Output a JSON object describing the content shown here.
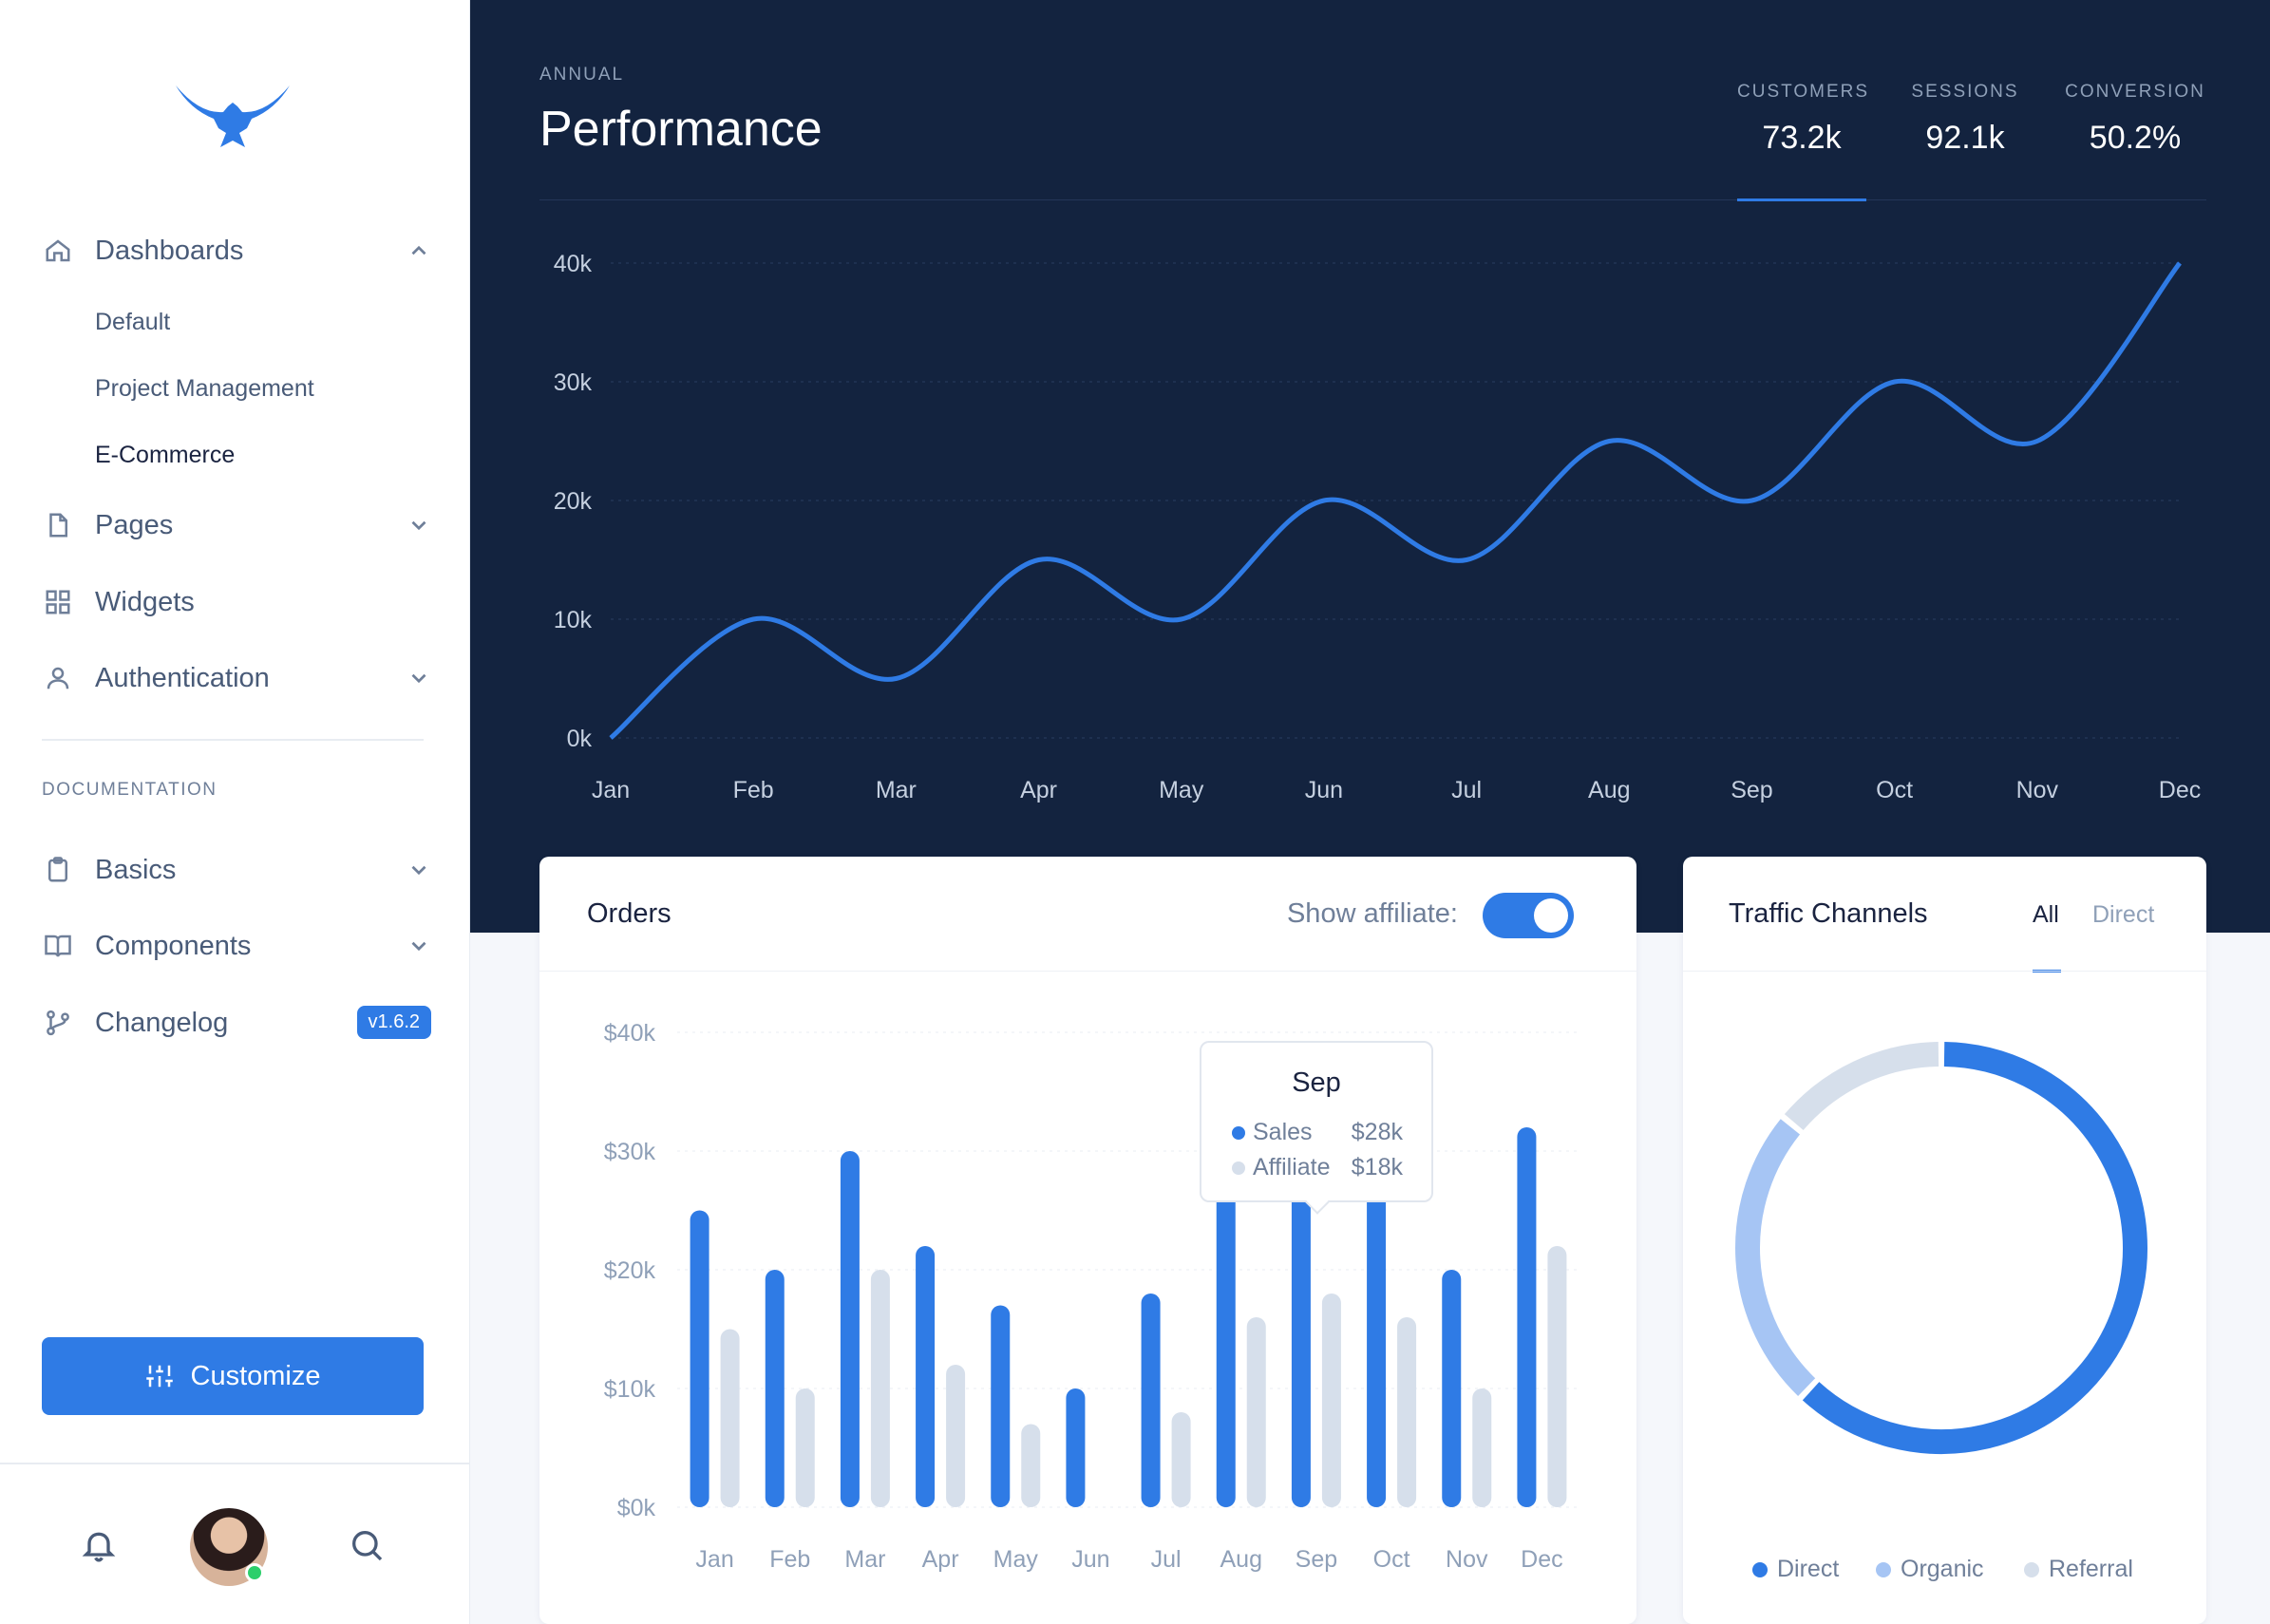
{
  "sidebar": {
    "nav": [
      {
        "label": "Dashboards",
        "icon": "home-icon"
      },
      {
        "label": "Pages",
        "icon": "file-icon"
      },
      {
        "label": "Widgets",
        "icon": "grid-icon"
      },
      {
        "label": "Authentication",
        "icon": "user-icon"
      }
    ],
    "dashboard_sub": [
      "Default",
      "Project Management",
      "E-Commerce"
    ],
    "section_title": "DOCUMENTATION",
    "doc_nav": [
      {
        "label": "Basics",
        "icon": "clipboard-icon"
      },
      {
        "label": "Components",
        "icon": "book-icon"
      },
      {
        "label": "Changelog",
        "icon": "git-branch-icon"
      }
    ],
    "changelog_badge": "v1.6.2",
    "customize_label": "Customize"
  },
  "header": {
    "eyebrow": "ANNUAL",
    "title": "Performance",
    "stats": [
      {
        "label": "CUSTOMERS",
        "value": "73.2k"
      },
      {
        "label": "SESSIONS",
        "value": "92.1k"
      },
      {
        "label": "CONVERSION",
        "value": "50.2%"
      }
    ]
  },
  "orders": {
    "title": "Orders",
    "toggle_label": "Show affiliate:",
    "tooltip": {
      "month": "Sep",
      "sales_label": "Sales",
      "sales_value": "$28k",
      "affiliate_label": "Affiliate",
      "affiliate_value": "$18k"
    }
  },
  "traffic": {
    "title": "Traffic Channels",
    "tabs": [
      "All",
      "Direct"
    ],
    "legend": [
      "Direct",
      "Organic",
      "Referral"
    ]
  },
  "colors": {
    "accent": "#2f7be5",
    "navy": "#13233f",
    "light_bar": "#d6dfeb",
    "organic": "#a6c5f4"
  },
  "chart_data": [
    {
      "type": "line",
      "categories": [
        "Jan",
        "Feb",
        "Mar",
        "Apr",
        "May",
        "Jun",
        "Jul",
        "Aug",
        "Sep",
        "Oct",
        "Nov",
        "Dec"
      ],
      "values": [
        0,
        10000,
        5000,
        15000,
        10000,
        20000,
        15000,
        25000,
        20000,
        30000,
        25000,
        40000
      ],
      "yticks": [
        "0k",
        "10k",
        "20k",
        "30k",
        "40k"
      ],
      "ylim": [
        0,
        40000
      ]
    },
    {
      "type": "bar",
      "categories": [
        "Jan",
        "Feb",
        "Mar",
        "Apr",
        "May",
        "Jun",
        "Jul",
        "Aug",
        "Sep",
        "Oct",
        "Nov",
        "Dec"
      ],
      "series": [
        {
          "name": "Sales",
          "values": [
            25000,
            20000,
            30000,
            22000,
            17000,
            10000,
            18000,
            28000,
            28000,
            28000,
            20000,
            32000
          ]
        },
        {
          "name": "Affiliate",
          "values": [
            15000,
            10000,
            20000,
            12000,
            7000,
            0,
            8000,
            16000,
            18000,
            16000,
            10000,
            22000
          ]
        }
      ],
      "yticks": [
        "$0k",
        "$10k",
        "$20k",
        "$30k",
        "$40k"
      ],
      "ylim": [
        0,
        40000
      ]
    },
    {
      "type": "pie",
      "categories": [
        "Direct",
        "Organic",
        "Referral"
      ],
      "values": [
        62,
        24,
        14
      ]
    }
  ]
}
